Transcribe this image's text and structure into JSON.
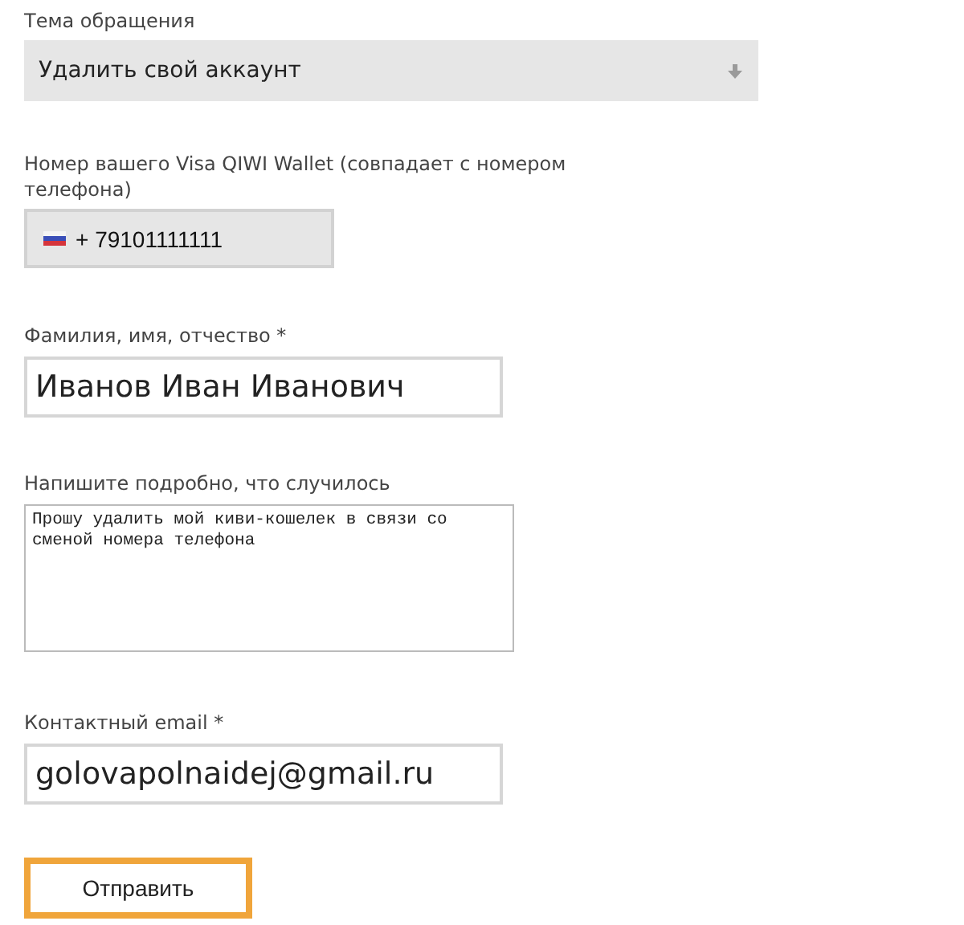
{
  "fields": [
    {
      "kind": "select",
      "label": "Тема обращения",
      "value": "Удалить свой аккаунт"
    },
    {
      "kind": "phone",
      "label": "Номер вашего Visa QIWI Wallet (совпадает с номером телефона)",
      "value": "+ 79101111111"
    },
    {
      "kind": "text",
      "label": "Фамилия, имя, отчество *",
      "value": "Иванов Иван Иванович"
    },
    {
      "kind": "textarea",
      "label": "Напишите подробно, что случилось",
      "value": "Прошу удалить мой киви-кошелек в связи со сменой номера телефона"
    },
    {
      "kind": "text",
      "label": "Контактный email *",
      "value": "golovapolnaidej@gmail.ru"
    }
  ],
  "submit_button": "Отправить"
}
